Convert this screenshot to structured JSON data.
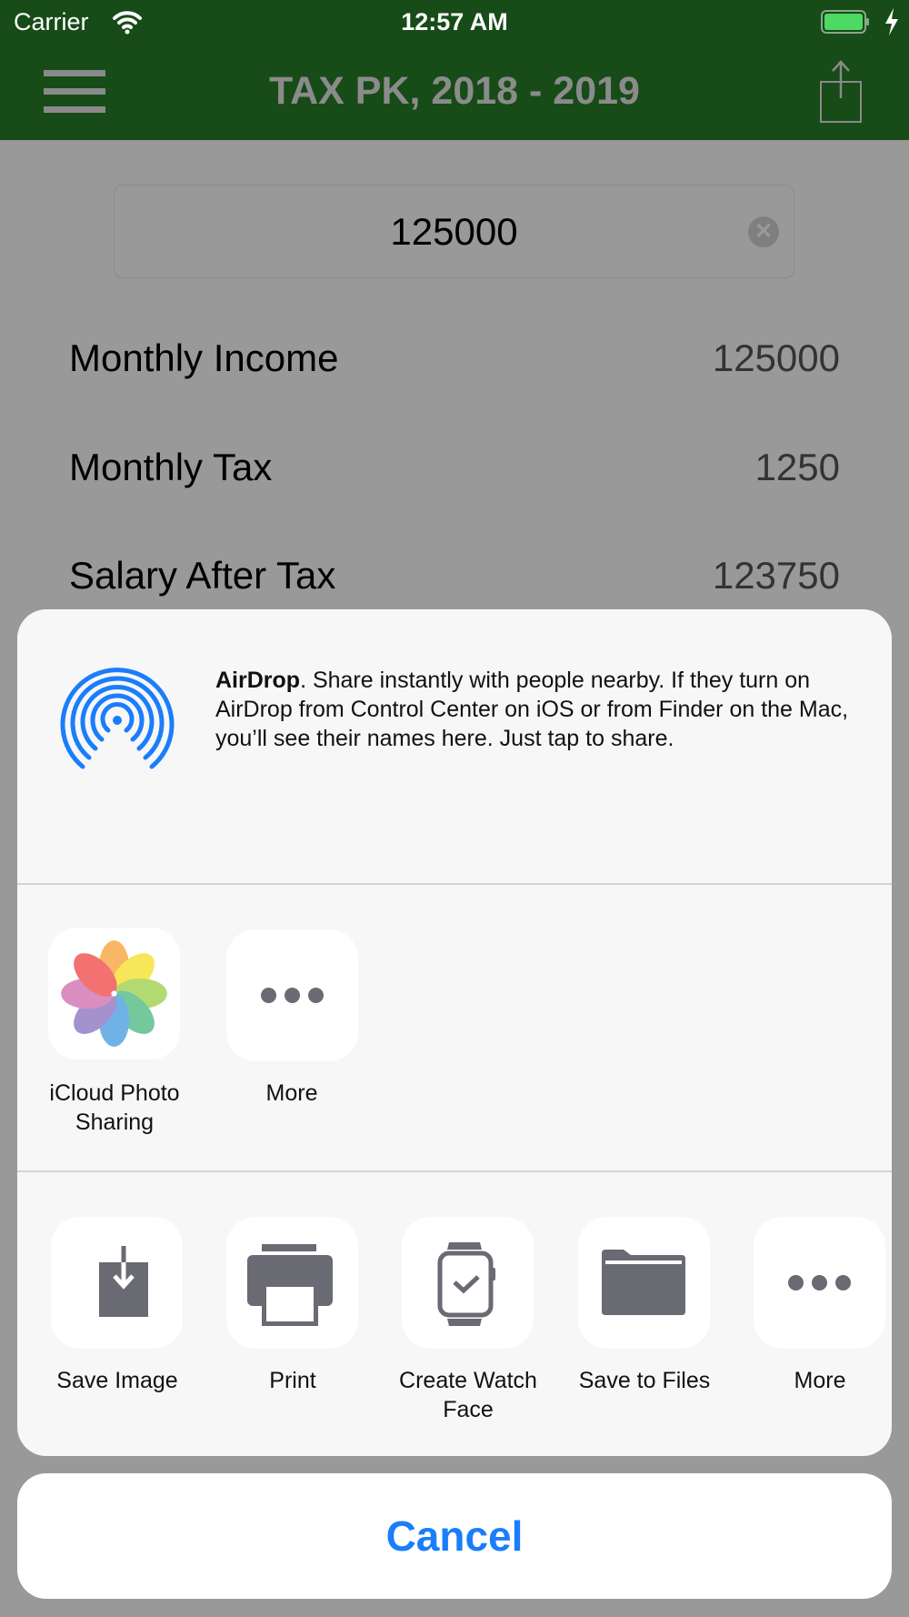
{
  "status_bar": {
    "carrier": "Carrier",
    "time": "12:57 AM",
    "battery_color": "#4cd964",
    "charging": true
  },
  "nav": {
    "title": "TAX PK, 2018 - 2019",
    "left_icon": "hamburger-menu-icon",
    "right_icon": "share-icon",
    "bar_color": "#174b17"
  },
  "salary_input": {
    "value": "125000",
    "clear_icon": "clear-circle-icon"
  },
  "results": [
    {
      "label": "Monthly Income",
      "value": "125000"
    },
    {
      "label": "Monthly Tax",
      "value": "1250"
    },
    {
      "label": "Salary After Tax",
      "value": "123750"
    }
  ],
  "share_sheet": {
    "airdrop": {
      "title": "AirDrop",
      "description": ". Share instantly with people nearby. If they turn on AirDrop from Control Center on iOS or from Finder on the Mac, you’ll see their names here. Just tap to share.",
      "icon": "airdrop-icon",
      "accent": "#1a7efb"
    },
    "apps": [
      {
        "label": "iCloud Photo Sharing",
        "icon": "photos-icon"
      },
      {
        "label": "More",
        "icon": "more-icon"
      }
    ],
    "actions": [
      {
        "label": "Save Image",
        "icon": "save-image-icon"
      },
      {
        "label": "Print",
        "icon": "printer-icon"
      },
      {
        "label": "Create Watch Face",
        "icon": "watch-icon"
      },
      {
        "label": "Save to Files",
        "icon": "folder-icon"
      },
      {
        "label": "More",
        "icon": "more-icon"
      }
    ]
  },
  "cancel_label": "Cancel"
}
